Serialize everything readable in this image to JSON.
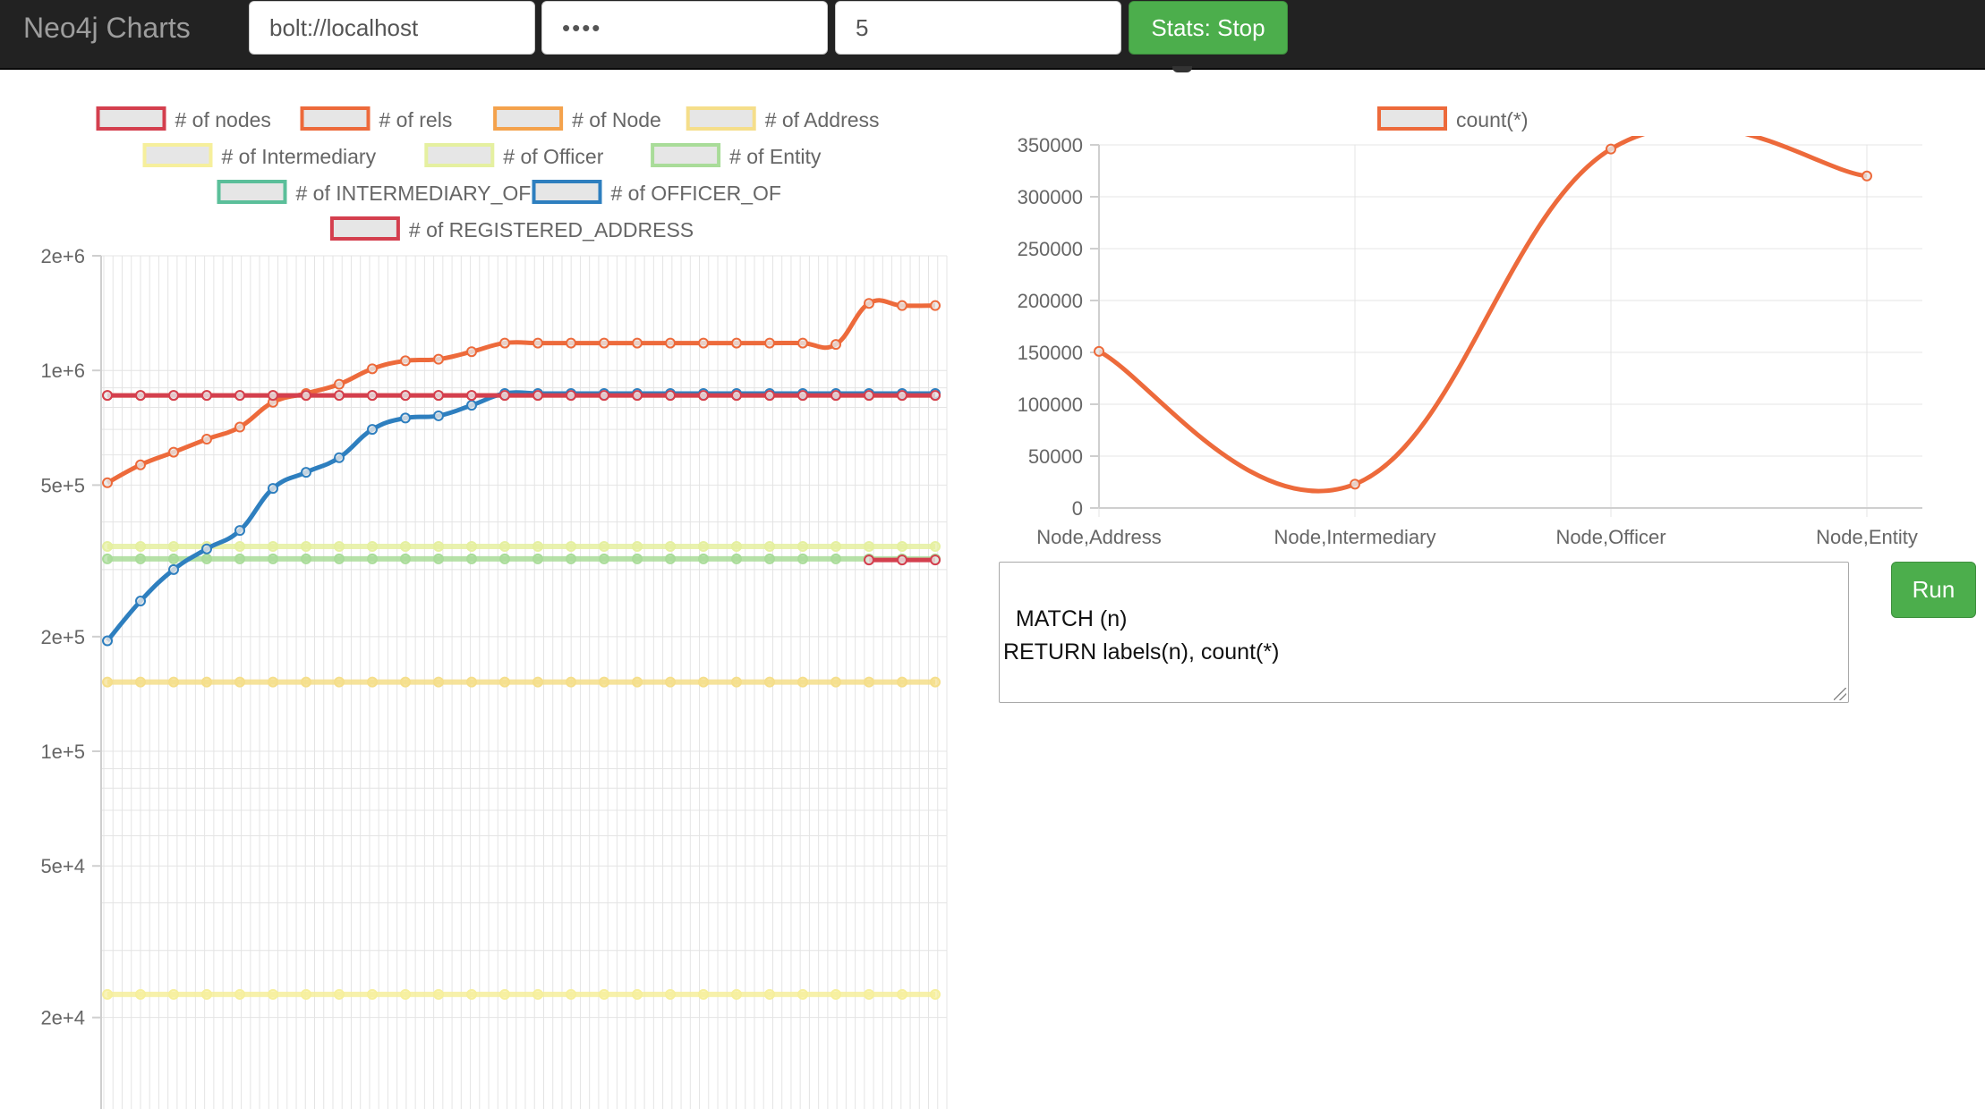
{
  "navbar": {
    "brand": "Neo4j Charts",
    "url_value": "bolt://localhost",
    "password_value": "••••",
    "interval_value": "5",
    "stats_button_label": "Stats: Stop"
  },
  "colors": {
    "navbar_bg": "#222222",
    "button_green": "#4cae4c",
    "nodes": "#d43f4e",
    "rels": "#ed6a3b",
    "node": "#f4a24c",
    "address": "#f5de8a",
    "intermediary": "#f6ef9c",
    "officer": "#e5f0a0",
    "entity": "#a9dc99",
    "intermediary_of": "#5bbf9a",
    "officer_of": "#2e7fbf",
    "registered_address": "#d43f4e"
  },
  "stats_chart": {
    "type": "line",
    "y_scale": "log",
    "y_ticks": [
      "2e+6",
      "1e+6",
      "5e+5",
      "2e+5",
      "1e+5",
      "5e+4",
      "2e+4"
    ],
    "legend": [
      {
        "key": "nodes",
        "label": "# of nodes"
      },
      {
        "key": "rels",
        "label": "# of rels"
      },
      {
        "key": "node",
        "label": "# of Node"
      },
      {
        "key": "address",
        "label": "# of Address"
      },
      {
        "key": "intermediary",
        "label": "# of Intermediary"
      },
      {
        "key": "officer",
        "label": "# of Officer"
      },
      {
        "key": "entity",
        "label": "# of Entity"
      },
      {
        "key": "intermediary_of",
        "label": "# of INTERMEDIARY_OF"
      },
      {
        "key": "officer_of",
        "label": "# of OFFICER_OF"
      },
      {
        "key": "registered_address",
        "label": "# of REGISTERED_ADDRESS"
      }
    ],
    "series": {
      "rels": [
        507000,
        565000,
        610000,
        660000,
        710000,
        825000,
        870000,
        920000,
        1010000,
        1060000,
        1070000,
        1120000,
        1180000,
        1180000,
        1180000,
        1180000,
        1180000,
        1180000,
        1180000,
        1180000,
        1180000,
        1180000,
        1170000,
        1500000,
        1480000,
        1480000
      ],
      "officer_of": [
        195000,
        248000,
        300000,
        340000,
        380000,
        490000,
        540000,
        590000,
        700000,
        750000,
        760000,
        810000,
        870000,
        870000,
        870000,
        870000,
        870000,
        870000,
        870000,
        870000,
        870000,
        870000,
        870000,
        870000,
        870000,
        870000
      ],
      "nodes": [
        860000,
        860000,
        860000,
        860000,
        860000,
        860000,
        860000,
        860000,
        860000,
        860000,
        860000,
        860000,
        860000,
        860000,
        860000,
        860000,
        860000,
        860000,
        860000,
        860000,
        860000,
        860000,
        860000,
        860000,
        860000,
        860000
      ],
      "node": [
        860000,
        860000,
        860000,
        860000,
        860000,
        860000,
        860000,
        860000,
        860000,
        860000,
        860000,
        860000,
        860000,
        860000,
        860000,
        860000,
        860000,
        860000,
        860000,
        860000,
        860000,
        860000,
        860000,
        860000,
        860000,
        860000
      ],
      "officer": [
        345000,
        345000,
        345000,
        345000,
        345000,
        345000,
        345000,
        345000,
        345000,
        345000,
        345000,
        345000,
        345000,
        345000,
        345000,
        345000,
        345000,
        345000,
        345000,
        345000,
        345000,
        345000,
        345000,
        345000,
        345000,
        345000
      ],
      "entity": [
        320000,
        320000,
        320000,
        320000,
        320000,
        320000,
        320000,
        320000,
        320000,
        320000,
        320000,
        320000,
        320000,
        320000,
        320000,
        320000,
        320000,
        320000,
        320000,
        320000,
        320000,
        320000,
        320000,
        320000,
        320000,
        320000
      ],
      "address": [
        152000,
        152000,
        152000,
        152000,
        152000,
        152000,
        152000,
        152000,
        152000,
        152000,
        152000,
        152000,
        152000,
        152000,
        152000,
        152000,
        152000,
        152000,
        152000,
        152000,
        152000,
        152000,
        152000,
        152000,
        152000,
        152000
      ],
      "intermediary": [
        23000,
        23000,
        23000,
        23000,
        23000,
        23000,
        23000,
        23000,
        23000,
        23000,
        23000,
        23000,
        23000,
        23000,
        23000,
        23000,
        23000,
        23000,
        23000,
        23000,
        23000,
        23000,
        23000,
        23000,
        23000,
        23000
      ],
      "registered_address": [
        null,
        null,
        null,
        null,
        null,
        null,
        null,
        null,
        null,
        null,
        null,
        null,
        null,
        null,
        null,
        null,
        null,
        null,
        null,
        null,
        null,
        null,
        null,
        318000,
        318000,
        318000
      ]
    }
  },
  "chart_data": {
    "type": "line",
    "categories": [
      "Node,Address",
      "Node,Intermediary",
      "Node,Officer",
      "Node,Entity"
    ],
    "series": [
      {
        "name": "count(*)",
        "values": [
          151000,
          23000,
          346000,
          320000
        ]
      }
    ],
    "y_ticks": [
      "350000",
      "300000",
      "250000",
      "200000",
      "150000",
      "100000",
      "50000",
      "0"
    ],
    "ylim": [
      0,
      350000
    ],
    "grid": true,
    "legend": "top"
  },
  "query": {
    "text": "MATCH (n)\nRETURN labels(n), count(*)",
    "run_label": "Run"
  }
}
